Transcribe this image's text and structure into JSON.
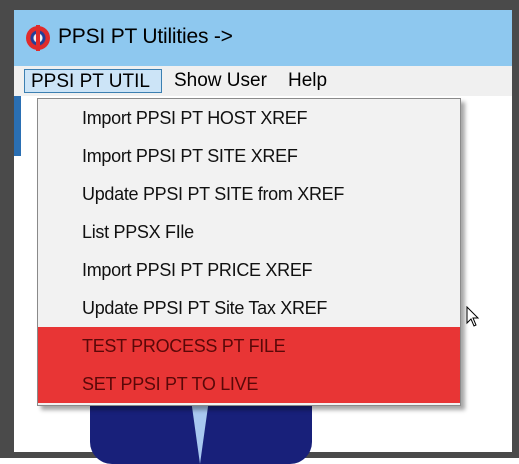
{
  "window": {
    "title": "PPSI PT Utilities ->"
  },
  "menubar": {
    "items": [
      "PPSI PT UTIL",
      "Show User",
      "Help"
    ]
  },
  "dropdown": {
    "items": [
      "Import PPSI PT HOST XREF",
      "Import PPSI PT SITE XREF",
      "Update PPSI PT SITE from XREF",
      "List PPSX FIle",
      "Import PPSI PT PRICE XREF",
      "Update PPSI PT Site Tax XREF",
      "TEST PROCESS PT FILE",
      "SET PPSI PT TO LIVE"
    ]
  },
  "colors": {
    "titlebar": "#8ec8ef",
    "menu_highlight": "#cce4f7",
    "danger_item": "#e83535"
  },
  "icons": [
    "app-logo-icon",
    "mouse-pointer-icon"
  ]
}
